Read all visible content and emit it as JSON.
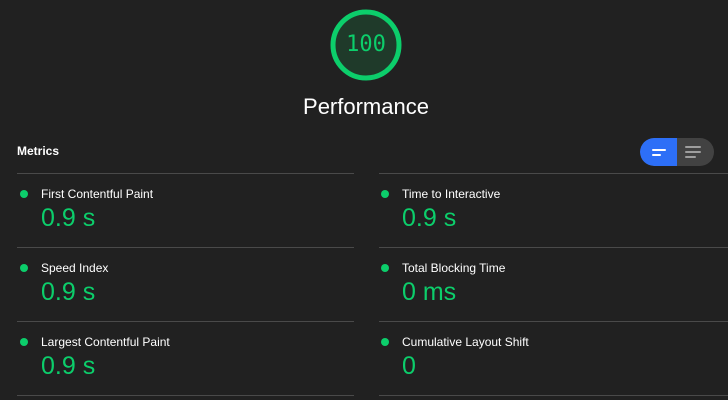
{
  "score": {
    "value": "100",
    "fraction": 1.0,
    "color": "#0cce6b"
  },
  "category": {
    "title": "Performance"
  },
  "metrics_section": {
    "title": "Metrics",
    "toggle": {
      "options": [
        "compact-view-icon",
        "expanded-view-icon"
      ],
      "selected": "compact-view-icon",
      "active_color": "#2d6ff7"
    },
    "metrics": [
      {
        "label": "First Contentful Paint",
        "value": "0.9 s",
        "status": "pass"
      },
      {
        "label": "Time to Interactive",
        "value": "0.9 s",
        "status": "pass"
      },
      {
        "label": "Speed Index",
        "value": "0.9 s",
        "status": "pass"
      },
      {
        "label": "Total Blocking Time",
        "value": "0 ms",
        "status": "pass"
      },
      {
        "label": "Largest Contentful Paint",
        "value": "0.9 s",
        "status": "pass"
      },
      {
        "label": "Cumulative Layout Shift",
        "value": "0",
        "status": "pass"
      }
    ]
  },
  "colors": {
    "background": "#212121",
    "pass": "#0cce6b",
    "divider": "#4a4a4a"
  }
}
